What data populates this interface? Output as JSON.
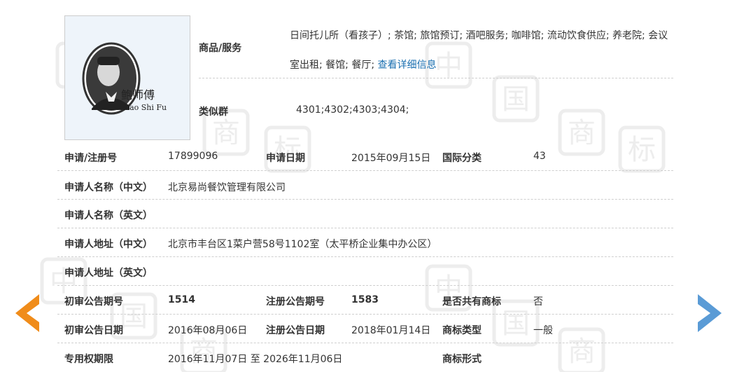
{
  "colors": {
    "link": "#1a6fb0",
    "arrow_prev": "#f08c1a",
    "arrow_next": "#5a9bd6",
    "divider": "#cfcfcf",
    "watermark": "#ededed"
  },
  "logo": {
    "cn": "鲍师傅",
    "en": "Bao Shi Fu"
  },
  "goods": {
    "label": "商品/服务",
    "text": "日间托儿所（看孩子）; 茶馆; 旅馆预订; 酒吧服务; 咖啡馆; 流动饮食供应; 养老院; 会议室出租; 餐馆; 餐厅;",
    "link": "查看详细信息"
  },
  "similar": {
    "label": "类似群",
    "value": "4301;4302;4303;4304;"
  },
  "row_reg": {
    "reg_no_label": "申请/注册号",
    "reg_no": "17899096",
    "app_date_label": "申请日期",
    "app_date": "2015年09月15日",
    "intl_label": "国际分类",
    "intl": "43"
  },
  "applicant_cn": {
    "label": "申请人名称（中文）",
    "value": "北京易尚餐饮管理有限公司"
  },
  "applicant_en": {
    "label": "申请人名称（英文）",
    "value": ""
  },
  "address_cn": {
    "label": "申请人地址（中文）",
    "value": "北京市丰台区1菜户营58号1102室（太平桥企业集中办公区）"
  },
  "address_en": {
    "label": "申请人地址（英文）",
    "value": ""
  },
  "row_pub": {
    "prelim_no_label": "初审公告期号",
    "prelim_no": "1514",
    "reg_pub_no_label": "注册公告期号",
    "reg_pub_no": "1583",
    "shared_label": "是否共有商标",
    "shared": "否"
  },
  "row_dates": {
    "prelim_date_label": "初审公告日期",
    "prelim_date": "2016年08月06日",
    "reg_pub_date_label": "注册公告日期",
    "reg_pub_date": "2018年01月14日",
    "type_label": "商标类型",
    "type": "一般"
  },
  "row_term": {
    "term_label": "专用权期限",
    "term": "2016年11月07日 至 2026年11月06日",
    "form_label": "商标形式",
    "form": ""
  },
  "watermark_text": [
    "中",
    "国",
    "商",
    "标"
  ]
}
